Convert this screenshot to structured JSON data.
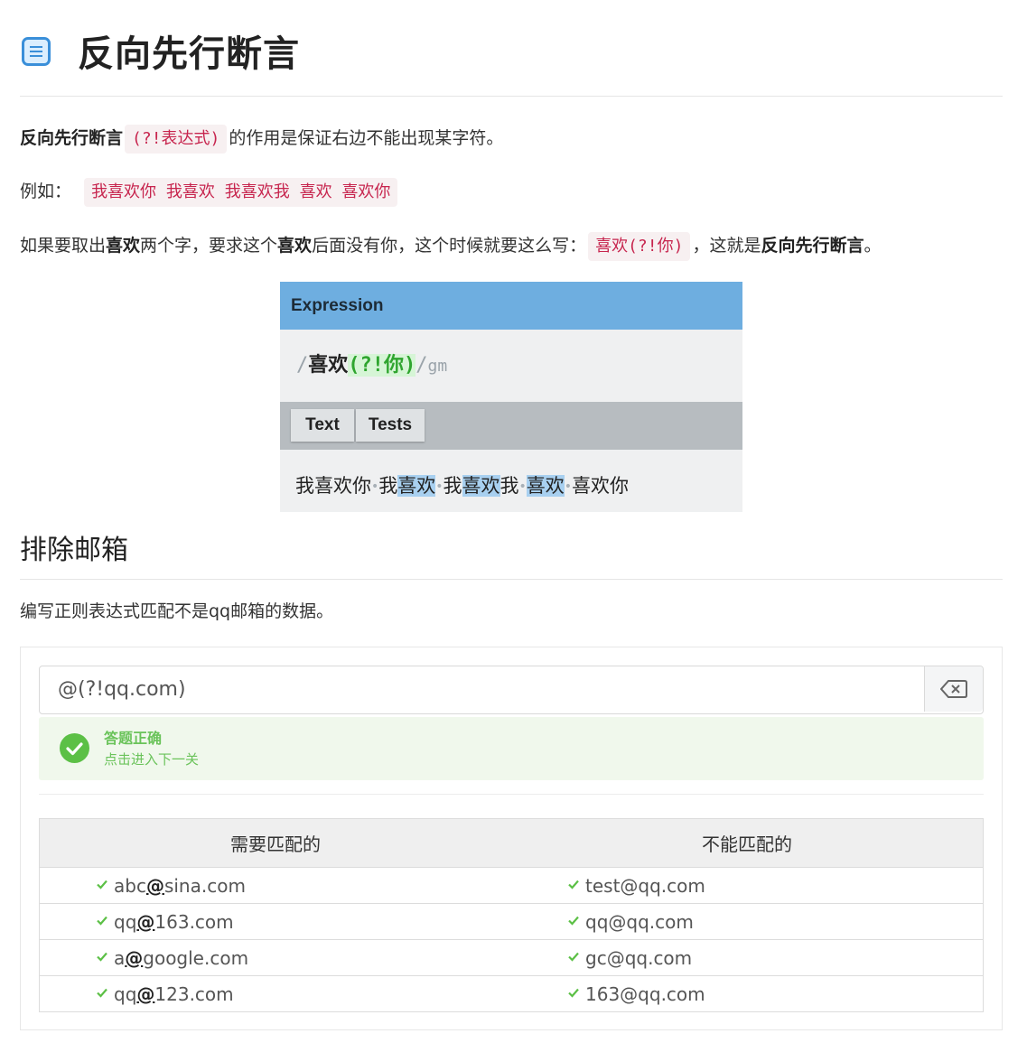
{
  "page": {
    "title": "反向先行断言"
  },
  "intro": {
    "term": "反向先行断言",
    "syntax": "(?!表达式)",
    "rest": "的作用是保证右边不能出现某字符。"
  },
  "example": {
    "label": "例如：",
    "text": "我喜欢你 我喜欢 我喜欢我 喜欢 喜欢你"
  },
  "explain": {
    "p1": "如果要取出",
    "w1": "喜欢",
    "p2": "两个字，要求这个",
    "w2": "喜欢",
    "p3": "后面没有你，这个时候就要这么写：",
    "code": "喜欢(?!你)",
    "p4": "，这就是",
    "term": "反向先行断言",
    "p5": "。"
  },
  "regex_figure": {
    "header": "Expression",
    "slash_open": "/",
    "literal": "喜欢",
    "group": "(?!你)",
    "slash_close": "/",
    "flags": "gm",
    "tabs": [
      "Text",
      "Tests"
    ],
    "segments": {
      "s1": "我喜欢你",
      "s2a": "我",
      "s2b": "喜欢",
      "s3a": "我",
      "s3b": "喜欢",
      "s3c": "我",
      "s4": "喜欢",
      "s5": "喜欢你"
    },
    "space_marker": "•"
  },
  "section": {
    "heading": "排除邮箱",
    "description": "编写正则表达式匹配不是qq邮箱的数据。"
  },
  "quiz": {
    "answer_value": "@(?!qq.com)",
    "clear_icon": "backspace-icon",
    "success_title": "答题正确",
    "success_link": "点击进入下一关",
    "colors": {
      "success": "#5cc046",
      "success_bg": "#f0f8ec"
    },
    "table": {
      "headers": [
        "需要匹配的",
        "不能匹配的"
      ],
      "rows": [
        {
          "match_pre": "abc",
          "match_at": "@",
          "match_post": "sina.com",
          "exclude": "test@qq.com"
        },
        {
          "match_pre": "qq",
          "match_at": "@",
          "match_post": "163.com",
          "exclude": "qq@qq.com"
        },
        {
          "match_pre": "a",
          "match_at": "@",
          "match_post": "google.com",
          "exclude": "gc@qq.com"
        },
        {
          "match_pre": "qq",
          "match_at": "@",
          "match_post": "123.com",
          "exclude": "163@qq.com"
        }
      ]
    }
  }
}
